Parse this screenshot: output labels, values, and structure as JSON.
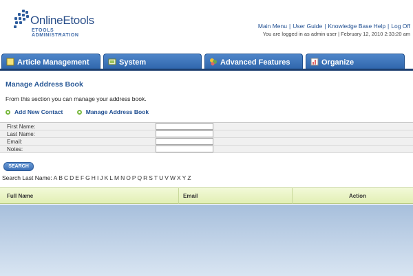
{
  "brand": {
    "title": "OnlineEtools",
    "subtitle": "ETOOLS ADMINISTRATION"
  },
  "top_links": [
    "Main Menu",
    "User Guide",
    "Knowledge Base Help",
    "Log Off"
  ],
  "login_info": "You are logged in as admin user | February 12, 2010 2:33:20 am",
  "tabs": [
    {
      "label": "Article Management",
      "icon": "article-icon"
    },
    {
      "label": "System",
      "icon": "system-icon"
    },
    {
      "label": "Advanced Features",
      "icon": "advanced-features-icon"
    },
    {
      "label": "Organize",
      "icon": "organize-icon"
    }
  ],
  "page": {
    "title": "Manage Address Book",
    "intro": "From this section you can manage your address book.",
    "actions": [
      "Add New Contact",
      "Manage Address Book"
    ]
  },
  "form": {
    "fields": [
      {
        "label": "First Name:",
        "value": ""
      },
      {
        "label": "Last Name:",
        "value": ""
      },
      {
        "label": "Email:",
        "value": ""
      },
      {
        "label": "Notes:",
        "value": ""
      }
    ],
    "search_button": "SEARCH"
  },
  "alpha_search": {
    "label": "Search Last Name:",
    "letters": [
      "A",
      "B",
      "C",
      "D",
      "E",
      "F",
      "G",
      "H",
      "I",
      "J",
      "K",
      "L",
      "M",
      "N",
      "O",
      "P",
      "Q",
      "R",
      "S",
      "T",
      "U",
      "V",
      "W",
      "X",
      "Y",
      "Z"
    ]
  },
  "results_table": {
    "columns": [
      "Full Name",
      "Email",
      "Action"
    ]
  },
  "colors": {
    "tab_blue": "#3a72b8",
    "link_blue": "#1f4e91",
    "header_green": "#e8f3c4",
    "bottom_gradient": "#b8cce4"
  }
}
